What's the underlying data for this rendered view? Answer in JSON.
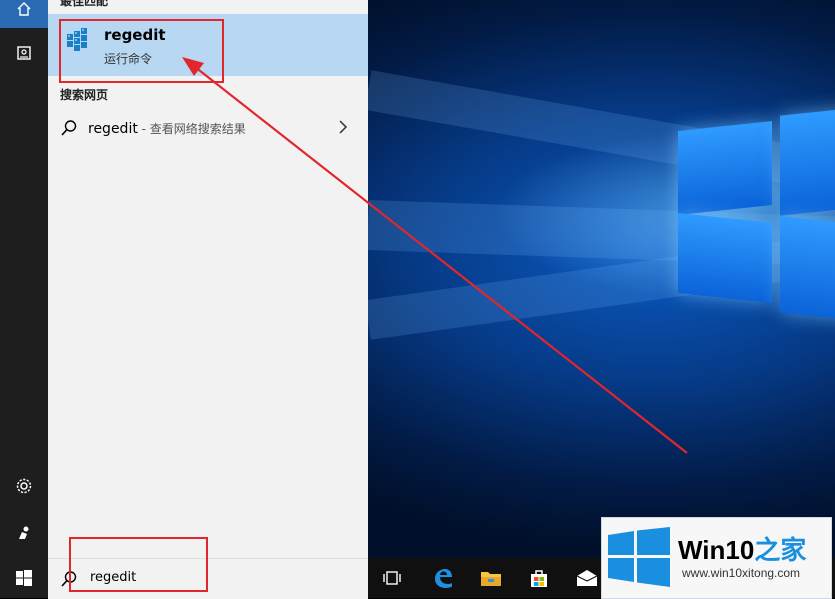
{
  "start_panel": {
    "section_top_label": "最佳匹配",
    "best_match": {
      "title": "regedit",
      "subtitle": "运行命令",
      "icon": "registry-editor-icon"
    },
    "section_web_label": "搜索网页",
    "web_result": {
      "query": "regedit",
      "suffix": " - 查看网络搜索结果",
      "icon": "search-icon",
      "chevron_icon": "chevron-right-icon"
    }
  },
  "rail": {
    "items": [
      {
        "icon": "home-icon"
      },
      {
        "icon": "document-icon"
      },
      {
        "icon": "gear-icon"
      },
      {
        "icon": "user-icon"
      }
    ]
  },
  "searchbox": {
    "value": "regedit",
    "icon": "search-icon"
  },
  "taskbar": {
    "items": [
      {
        "icon": "windows-start-icon"
      },
      {
        "icon": "task-view-icon"
      },
      {
        "icon": "edge-icon"
      },
      {
        "icon": "file-explorer-icon"
      },
      {
        "icon": "store-icon"
      },
      {
        "icon": "mail-icon"
      }
    ]
  },
  "watermark": {
    "brand_prefix": "Win10",
    "brand_suffix": "之家",
    "url": "www.win10xitong.com"
  },
  "colors": {
    "annotation_red": "#e1262c",
    "selection_blue": "#b8d7f3",
    "accent_blue": "#2b6bb3"
  }
}
